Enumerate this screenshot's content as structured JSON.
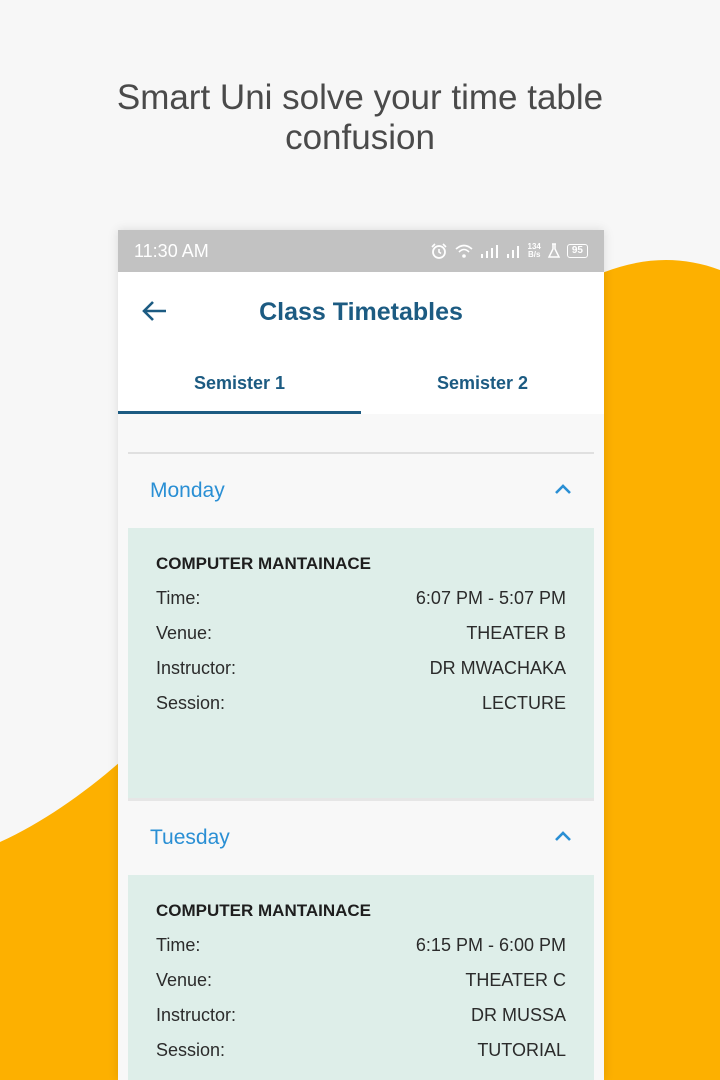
{
  "headline": "Smart Uni solve your time table\nconfusion",
  "colors": {
    "accent_yellow": "#FDB000",
    "primary": "#1C5B82",
    "day_blue": "#2A8FD4",
    "card_bg": "#DEEEE9"
  },
  "statusbar": {
    "time": "11:30 AM",
    "net_speed_value": "134",
    "net_speed_unit": "B/s",
    "battery": "95"
  },
  "appbar": {
    "title": "Class Timetables",
    "back_icon": "arrow-left-icon"
  },
  "tabs": [
    {
      "label": "Semister 1",
      "active": true
    },
    {
      "label": "Semister 2",
      "active": false
    }
  ],
  "days": [
    {
      "name": "Monday",
      "expanded": true,
      "classes": [
        {
          "course": "COMPUTER MANTAINACE",
          "time_label": "Time:",
          "time": "6:07 PM - 5:07 PM",
          "venue_label": "Venue:",
          "venue": "THEATER B",
          "instructor_label": "Instructor:",
          "instructor": "DR MWACHAKA",
          "session_label": "Session:",
          "session": "LECTURE"
        }
      ]
    },
    {
      "name": "Tuesday",
      "expanded": true,
      "classes": [
        {
          "course": "COMPUTER MANTAINACE",
          "time_label": "Time:",
          "time": "6:15 PM - 6:00 PM",
          "venue_label": "Venue:",
          "venue": "THEATER C",
          "instructor_label": "Instructor:",
          "instructor": "DR MUSSA",
          "session_label": "Session:",
          "session": "TUTORIAL"
        }
      ]
    }
  ]
}
